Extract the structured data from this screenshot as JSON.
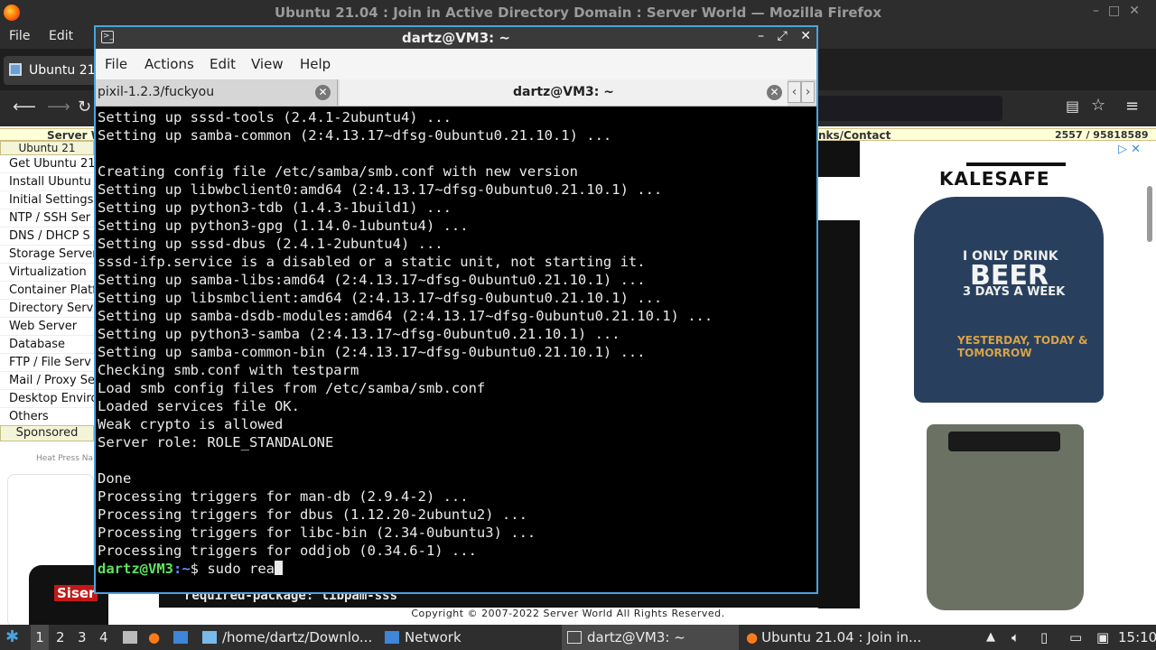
{
  "firefox": {
    "title": "Ubuntu 21.04 : Join in Active Directory Domain : Server World — Mozilla Firefox",
    "menu": [
      "File",
      "Edit"
    ],
    "tab_label": "Ubuntu 21",
    "page": {
      "header_left": "Server W",
      "header_links": "nks/Contact",
      "header_counter": "2557 / 95818589",
      "sidebar_head": "Ubuntu 21",
      "sidebar_items": [
        "Get Ubuntu 21",
        "Install Ubuntu",
        "Initial Settings",
        "NTP / SSH Ser",
        "DNS / DHCP S",
        "Storage Server",
        "Virtualization",
        "Container Platf",
        "Directory Serve",
        "Web Server",
        "Database",
        "FTP / File Serv",
        "Mail / Proxy Se",
        "Desktop Enviro",
        "Others"
      ],
      "sponsored": "Sponsored",
      "heat_ad": "Heat Press Na",
      "siser": "Siser",
      "code_line": "required-package: libpam-sss",
      "copyright": "Copyright © 2007-2022 Server World All Rights Reserved.",
      "ad": {
        "brand": "KALESAFE",
        "shirt_line1": "I ONLY DRINK",
        "shirt_line2": "BEER",
        "shirt_line3": "3 DAYS A WEEK",
        "shirt_line4": "YESTERDAY, TODAY & TOMORROW"
      }
    }
  },
  "terminal": {
    "title": "dartz@VM3: ~",
    "menu": [
      "File",
      "Actions",
      "Edit",
      "View",
      "Help"
    ],
    "tabs": [
      "pixil-1.2.3/fuckyou",
      "dartz@VM3: ~"
    ],
    "lines": [
      "Setting up sssd-tools (2.4.1-2ubuntu4) ...",
      "Setting up samba-common (2:4.13.17~dfsg-0ubuntu0.21.10.1) ...",
      "",
      "Creating config file /etc/samba/smb.conf with new version",
      "Setting up libwbclient0:amd64 (2:4.13.17~dfsg-0ubuntu0.21.10.1) ...",
      "Setting up python3-tdb (1.4.3-1build1) ...",
      "Setting up python3-gpg (1.14.0-1ubuntu4) ...",
      "Setting up sssd-dbus (2.4.1-2ubuntu4) ...",
      "sssd-ifp.service is a disabled or a static unit, not starting it.",
      "Setting up samba-libs:amd64 (2:4.13.17~dfsg-0ubuntu0.21.10.1) ...",
      "Setting up libsmbclient:amd64 (2:4.13.17~dfsg-0ubuntu0.21.10.1) ...",
      "Setting up samba-dsdb-modules:amd64 (2:4.13.17~dfsg-0ubuntu0.21.10.1) ...",
      "Setting up python3-samba (2:4.13.17~dfsg-0ubuntu0.21.10.1) ...",
      "Setting up samba-common-bin (2:4.13.17~dfsg-0ubuntu0.21.10.1) ...",
      "Checking smb.conf with testparm",
      "Load smb config files from /etc/samba/smb.conf",
      "Loaded services file OK.",
      "Weak crypto is allowed",
      "Server role: ROLE_STANDALONE",
      "",
      "Done",
      "Processing triggers for man-db (2.9.4-2) ...",
      "Processing triggers for dbus (1.12.20-2ubuntu2) ...",
      "Processing triggers for libc-bin (2.34-0ubuntu3) ...",
      "Processing triggers for oddjob (0.34.6-1) ..."
    ],
    "prompt_user": "dartz@VM3",
    "prompt_path": ":~",
    "prompt_symbol": "$",
    "command": " sudo rea"
  },
  "taskbar": {
    "workspaces": [
      "1",
      "2",
      "3",
      "4"
    ],
    "apps": [
      "/home/dartz/Downlo...",
      "Network",
      "dartz@VM3: ~",
      "Ubuntu 21.04 : Join in..."
    ],
    "clock": "15:10"
  }
}
